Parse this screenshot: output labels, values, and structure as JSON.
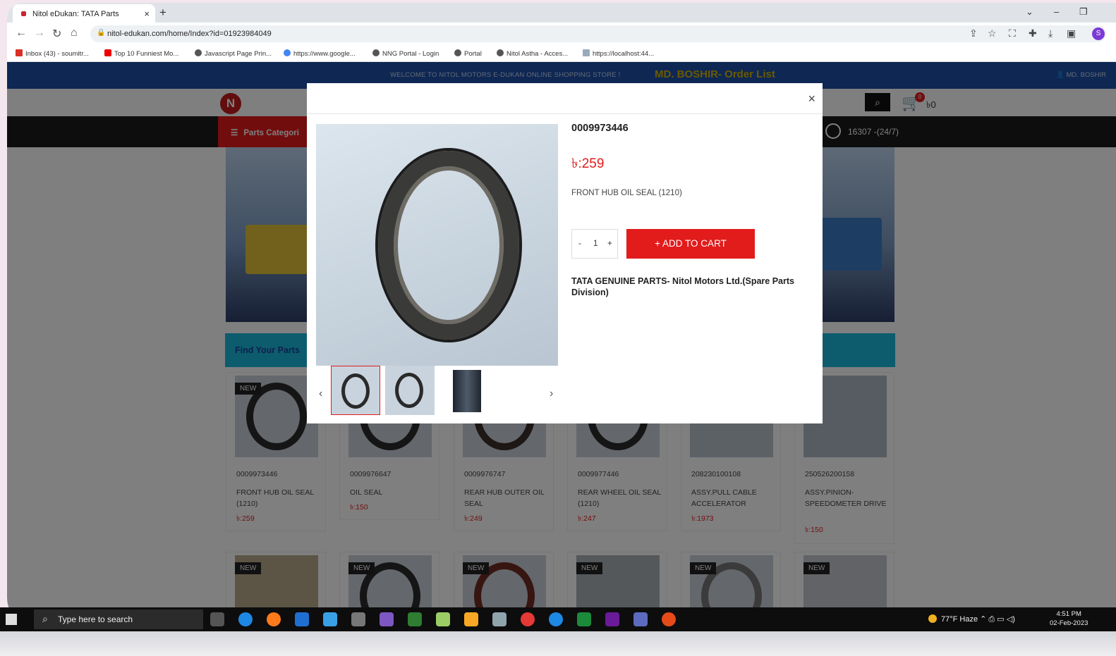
{
  "browser": {
    "tab_title": "Nitol eDukan: TATA Parts",
    "tab_close": "×",
    "new_tab": "+",
    "url": "nitol-edukan.com/home/Index?id=01923984049",
    "bookmarks": [
      "Inbox (43) - soumitr...",
      "Top 10 Funniest Mo...",
      "Javascript Page Prin...",
      "https://www.google...",
      "NNG Portal - Login",
      "Portal",
      "Nitol Astha - Acces...",
      "https://localhost:44..."
    ],
    "profile_initial": "S"
  },
  "site": {
    "welcome": "WELCOME TO NITOL MOTORS E-DUKAN ONLINE SHOPPING STORE !",
    "order_list": "MD. BOSHIR- Order List",
    "user": "MD. BOSHIR",
    "cart_count": "0",
    "cart_total": "৳0",
    "parts_category": "Parts Categori",
    "hotline": "16307 -(24/7)",
    "find_parts": "Find Your Parts",
    "products": [
      {
        "badge": "NEW",
        "code": "0009973446",
        "name": "FRONT HUB OIL SEAL (1210)",
        "price": "৳:259"
      },
      {
        "badge": "",
        "code": "0009976647",
        "name": "OIL SEAL",
        "price": "৳:150"
      },
      {
        "badge": "",
        "code": "0009976747",
        "name": "REAR HUB OUTER OIL SEAL",
        "price": "৳:249"
      },
      {
        "badge": "",
        "code": "0009977446",
        "name": "REAR WHEEL OIL SEAL (1210)",
        "price": "৳:247"
      },
      {
        "badge": "",
        "code": "208230100108",
        "name": "ASSY.PULL CABLE ACCELERATOR",
        "price": "৳:1973"
      },
      {
        "badge": "",
        "code": "250526200158",
        "name": "ASSY.PINION-SPEEDOMETER DRIVE",
        "price": "৳:150"
      }
    ],
    "row2_badges": [
      "NEW",
      "NEW",
      "NEW",
      "NEW",
      "NEW",
      "NEW"
    ]
  },
  "modal": {
    "close": "×",
    "code": "0009973446",
    "price": "৳:259",
    "description": "FRONT HUB OIL SEAL (1210)",
    "qty_minus": "-",
    "qty_value": "1",
    "qty_plus": "+",
    "add_to_cart": "+ ADD TO CART",
    "brand_note": "TATA GENUINE PARTS- Nitol Motors Ltd.(Spare Parts Division)",
    "prev": "‹",
    "next": "›"
  },
  "taskbar": {
    "search_placeholder": "Type here to search",
    "weather": "77°F  Haze",
    "time": "4:51 PM",
    "date": "02-Feb-2023"
  },
  "colors": {
    "brand_blue": "#1d4fa6",
    "brand_red": "#e21b1b",
    "find_bar": "#18b9dc"
  }
}
